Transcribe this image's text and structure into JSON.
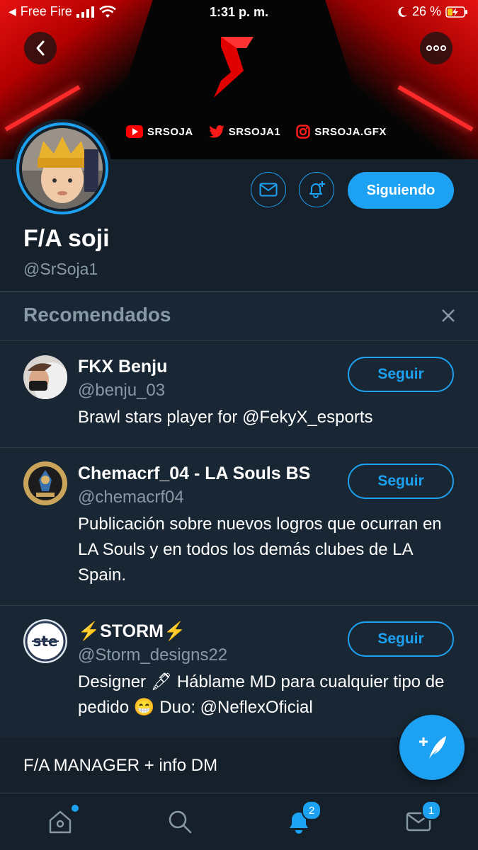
{
  "status_bar": {
    "carrier": "Free Fire",
    "time": "1:31 p. m.",
    "battery": "26 %"
  },
  "banner": {
    "socials": [
      {
        "icon": "youtube-icon",
        "label": "SRSOJA"
      },
      {
        "icon": "twitter-icon",
        "label": "SRSOJA1"
      },
      {
        "icon": "instagram-icon",
        "label": "SRSOJA.GFX"
      }
    ]
  },
  "profile": {
    "name": "F/A soji",
    "handle": "@SrSoja1",
    "following_label": "Siguiendo",
    "bio_line": "F/A MANAGER + info DM"
  },
  "recommendations": {
    "title": "Recomendados",
    "users": [
      {
        "name": "FKX Benju",
        "handle": "@benju_03",
        "bio": "Brawl stars player for @FekyX_esports",
        "button": "Seguir"
      },
      {
        "name": "Chemacrf_04 - LA Souls BS",
        "handle": "@chemacrf04",
        "bio": "Publicación sobre nuevos logros que ocurran en LA Souls y en todos los demás clubes de LA Spain.",
        "button": "Seguir"
      },
      {
        "name": "⚡️STORM⚡️",
        "handle": "@Storm_designs22",
        "bio": "Designer 🖋 Háblame MD para cualquier tipo de pedido 😁 Duo: @NeflexOficial",
        "button": "Seguir"
      }
    ]
  },
  "tabbar": {
    "notifications_badge": "2",
    "messages_badge": "1"
  },
  "colors": {
    "background": "#15202b",
    "card": "#192734",
    "accent": "#1da1f2",
    "muted": "#8899a6"
  }
}
